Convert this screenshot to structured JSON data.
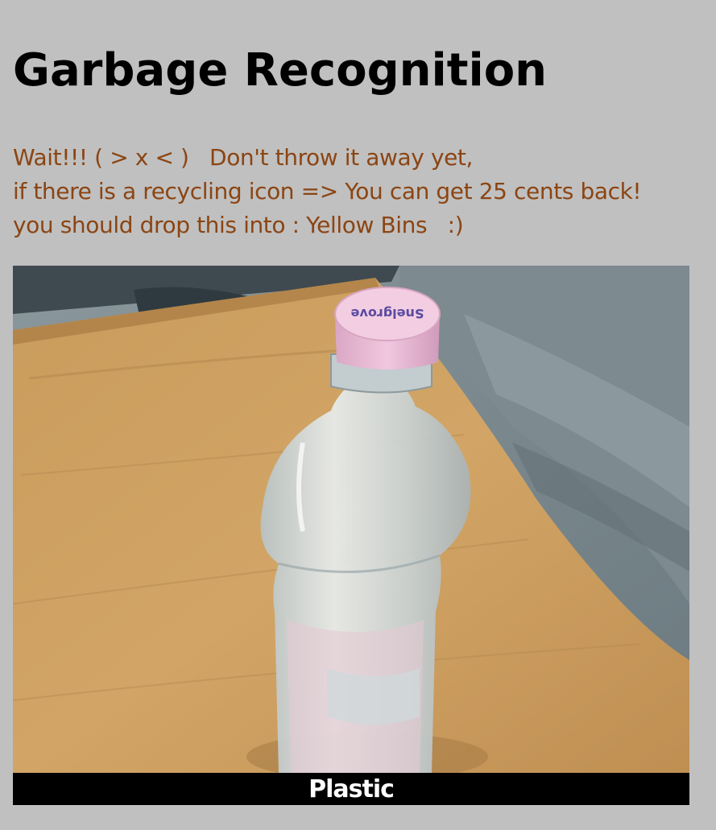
{
  "page": {
    "title": "Garbage Recognition"
  },
  "message": {
    "line1": "Wait!!! ( > x < )   Don't throw it away yet,",
    "line2": "if there is a recycling icon => You can get 25 cents back!",
    "line3": "you should drop this into : Yellow Bins   :)"
  },
  "photo": {
    "subject": "plastic water bottle with pink cap on wooden desk"
  },
  "result": {
    "label": "Plastic"
  },
  "colors": {
    "background": "#c0c0c0",
    "title_text": "#000000",
    "message_text": "#8b4513",
    "caption_bar": "#000000",
    "caption_text": "#ffffff"
  }
}
